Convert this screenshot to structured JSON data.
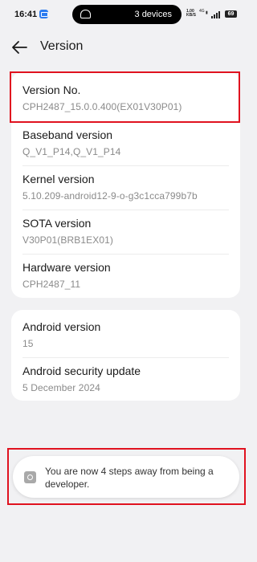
{
  "status_bar": {
    "time": "16:41",
    "pill_label": "3 devices",
    "net_speed_value": "1.00",
    "net_speed_unit": "KB/S",
    "net_type": "4G",
    "battery_level": "69",
    "icons": [
      "message-icon",
      "hotspot-icon",
      "sim-icon",
      "signal-icon",
      "battery-icon"
    ]
  },
  "header": {
    "title": "Version",
    "back_icon": "arrow-left-icon"
  },
  "card1": {
    "items": [
      {
        "title": "Version No.",
        "value": "CPH2487_15.0.0.400(EX01V30P01)"
      },
      {
        "title": "Baseband version",
        "value": "Q_V1_P14,Q_V1_P14"
      },
      {
        "title": "Kernel version",
        "value": "5.10.209-android12-9-o-g3c1cca799b7b"
      },
      {
        "title": "SOTA version",
        "value": "V30P01(BRB1EX01)"
      },
      {
        "title": "Hardware version",
        "value": "CPH2487_11"
      }
    ]
  },
  "card2": {
    "items": [
      {
        "title": "Android version",
        "value": "15"
      },
      {
        "title": "Android security update",
        "value": "5 December 2024"
      }
    ]
  },
  "toast": {
    "icon": "settings-gear-icon",
    "text": "You are now 4 steps away from being a developer."
  },
  "colors": {
    "background": "#f1f1f3",
    "card": "#ffffff",
    "highlight": "#e0121f",
    "secondary_text": "#8a8a8a"
  }
}
